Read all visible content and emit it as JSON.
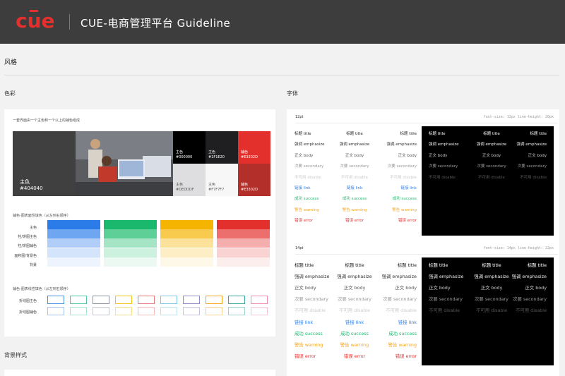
{
  "header": {
    "logo_text": "cue",
    "title": "CUE-电商管理平台 Guideline"
  },
  "page": {
    "title": "风格"
  },
  "sections": {
    "color": "色彩",
    "font": "字体",
    "background": "背景样式"
  },
  "color_card": {
    "intro": "一套界面由一个主色和一个以上的辅色组成",
    "main_swatch": {
      "name": "主色",
      "hex": "#404040"
    },
    "swatches": [
      {
        "name": "主色",
        "hex": "#000000",
        "bg": "#000000",
        "fg": "#ffffff"
      },
      {
        "name": "主色",
        "hex": "#1F1E20",
        "bg": "#1f1e20",
        "fg": "#ffffff"
      },
      {
        "name": "辅色",
        "hex": "#E3302D",
        "bg": "#e3302d",
        "fg": "#ffffff"
      },
      {
        "name": "主色",
        "hex": "#DEDDDF",
        "bg": "#dedddf",
        "fg": "#555555"
      },
      {
        "name": "主色",
        "hex": "#F7F7F7",
        "bg": "#f7f7f7",
        "fg": "#555555"
      },
      {
        "name": "辅色",
        "hex": "#E3302D",
        "bg": "#b3302a",
        "fg": "#ffffff"
      }
    ],
    "fill_title": "辅色-图表面性填色（从左到右顺序）",
    "fill_rows": [
      "主色",
      "柱/饼图主色",
      "柱/饼图辅色",
      "面积图/背景色",
      "背景"
    ],
    "fill_palettes": [
      [
        "#2b7ce9",
        "#6ea6f2",
        "#b1cef8",
        "#d4e4fb",
        "#eef4fd"
      ],
      [
        "#19b86c",
        "#5fcf98",
        "#a5e5c5",
        "#cdf1df",
        "#ebf9f2"
      ],
      [
        "#f5b400",
        "#f8ca4d",
        "#fbe19a",
        "#fdeec5",
        "#fef8e8"
      ],
      [
        "#e3302d",
        "#ec6f6d",
        "#f4aead",
        "#f9d3d2",
        "#fdeeee"
      ]
    ],
    "line_title": "辅色-图表线性填色（从左到右顺序）",
    "line_rows": [
      "折线图主色",
      "折线图辅色"
    ],
    "line_colors": [
      [
        "#4a90e2",
        "#50c8a8",
        "#8a94a6",
        "#f0c419",
        "#e87c7c",
        "#7ec8e3",
        "#8e8cc8",
        "#f5a623",
        "#3aa99f",
        "#f08cb0"
      ],
      [
        "#a6c8f0",
        "#a8e4d4",
        "#c4cad2",
        "#f7e18c",
        "#f3bdbd",
        "#bee3f1",
        "#c6c5e3",
        "#fad292",
        "#9dd4cf",
        "#f7c5d8"
      ]
    ]
  },
  "font_card": {
    "blocks": [
      {
        "size": "12pt",
        "spec": "font-size: 12px    line-height: 20px"
      },
      {
        "size": "14pt",
        "spec": "font-size: 14px    line-height: 22px"
      }
    ],
    "rows": [
      {
        "text": "标题 title",
        "color": "#222222",
        "dark": "#ffffff"
      },
      {
        "text": "强调 emphasize",
        "color": "#333333",
        "dark": "#eeeeee"
      },
      {
        "text": "正文 body",
        "color": "#555555",
        "dark": "#cccccc"
      },
      {
        "text": "次要 secondary",
        "color": "#999999",
        "dark": "#999999"
      },
      {
        "text": "不可用 disable",
        "color": "#cccccc",
        "dark": "#555555"
      },
      {
        "text": "链接 link",
        "color": "#2b7ce9",
        "dark": null
      },
      {
        "text": "成功 success",
        "color": "#19b86c",
        "dark": null
      },
      {
        "text": "警告 warning",
        "color": "#f5a623",
        "dark": null
      },
      {
        "text": "错误 error",
        "color": "#e3302d",
        "dark": null
      }
    ]
  }
}
